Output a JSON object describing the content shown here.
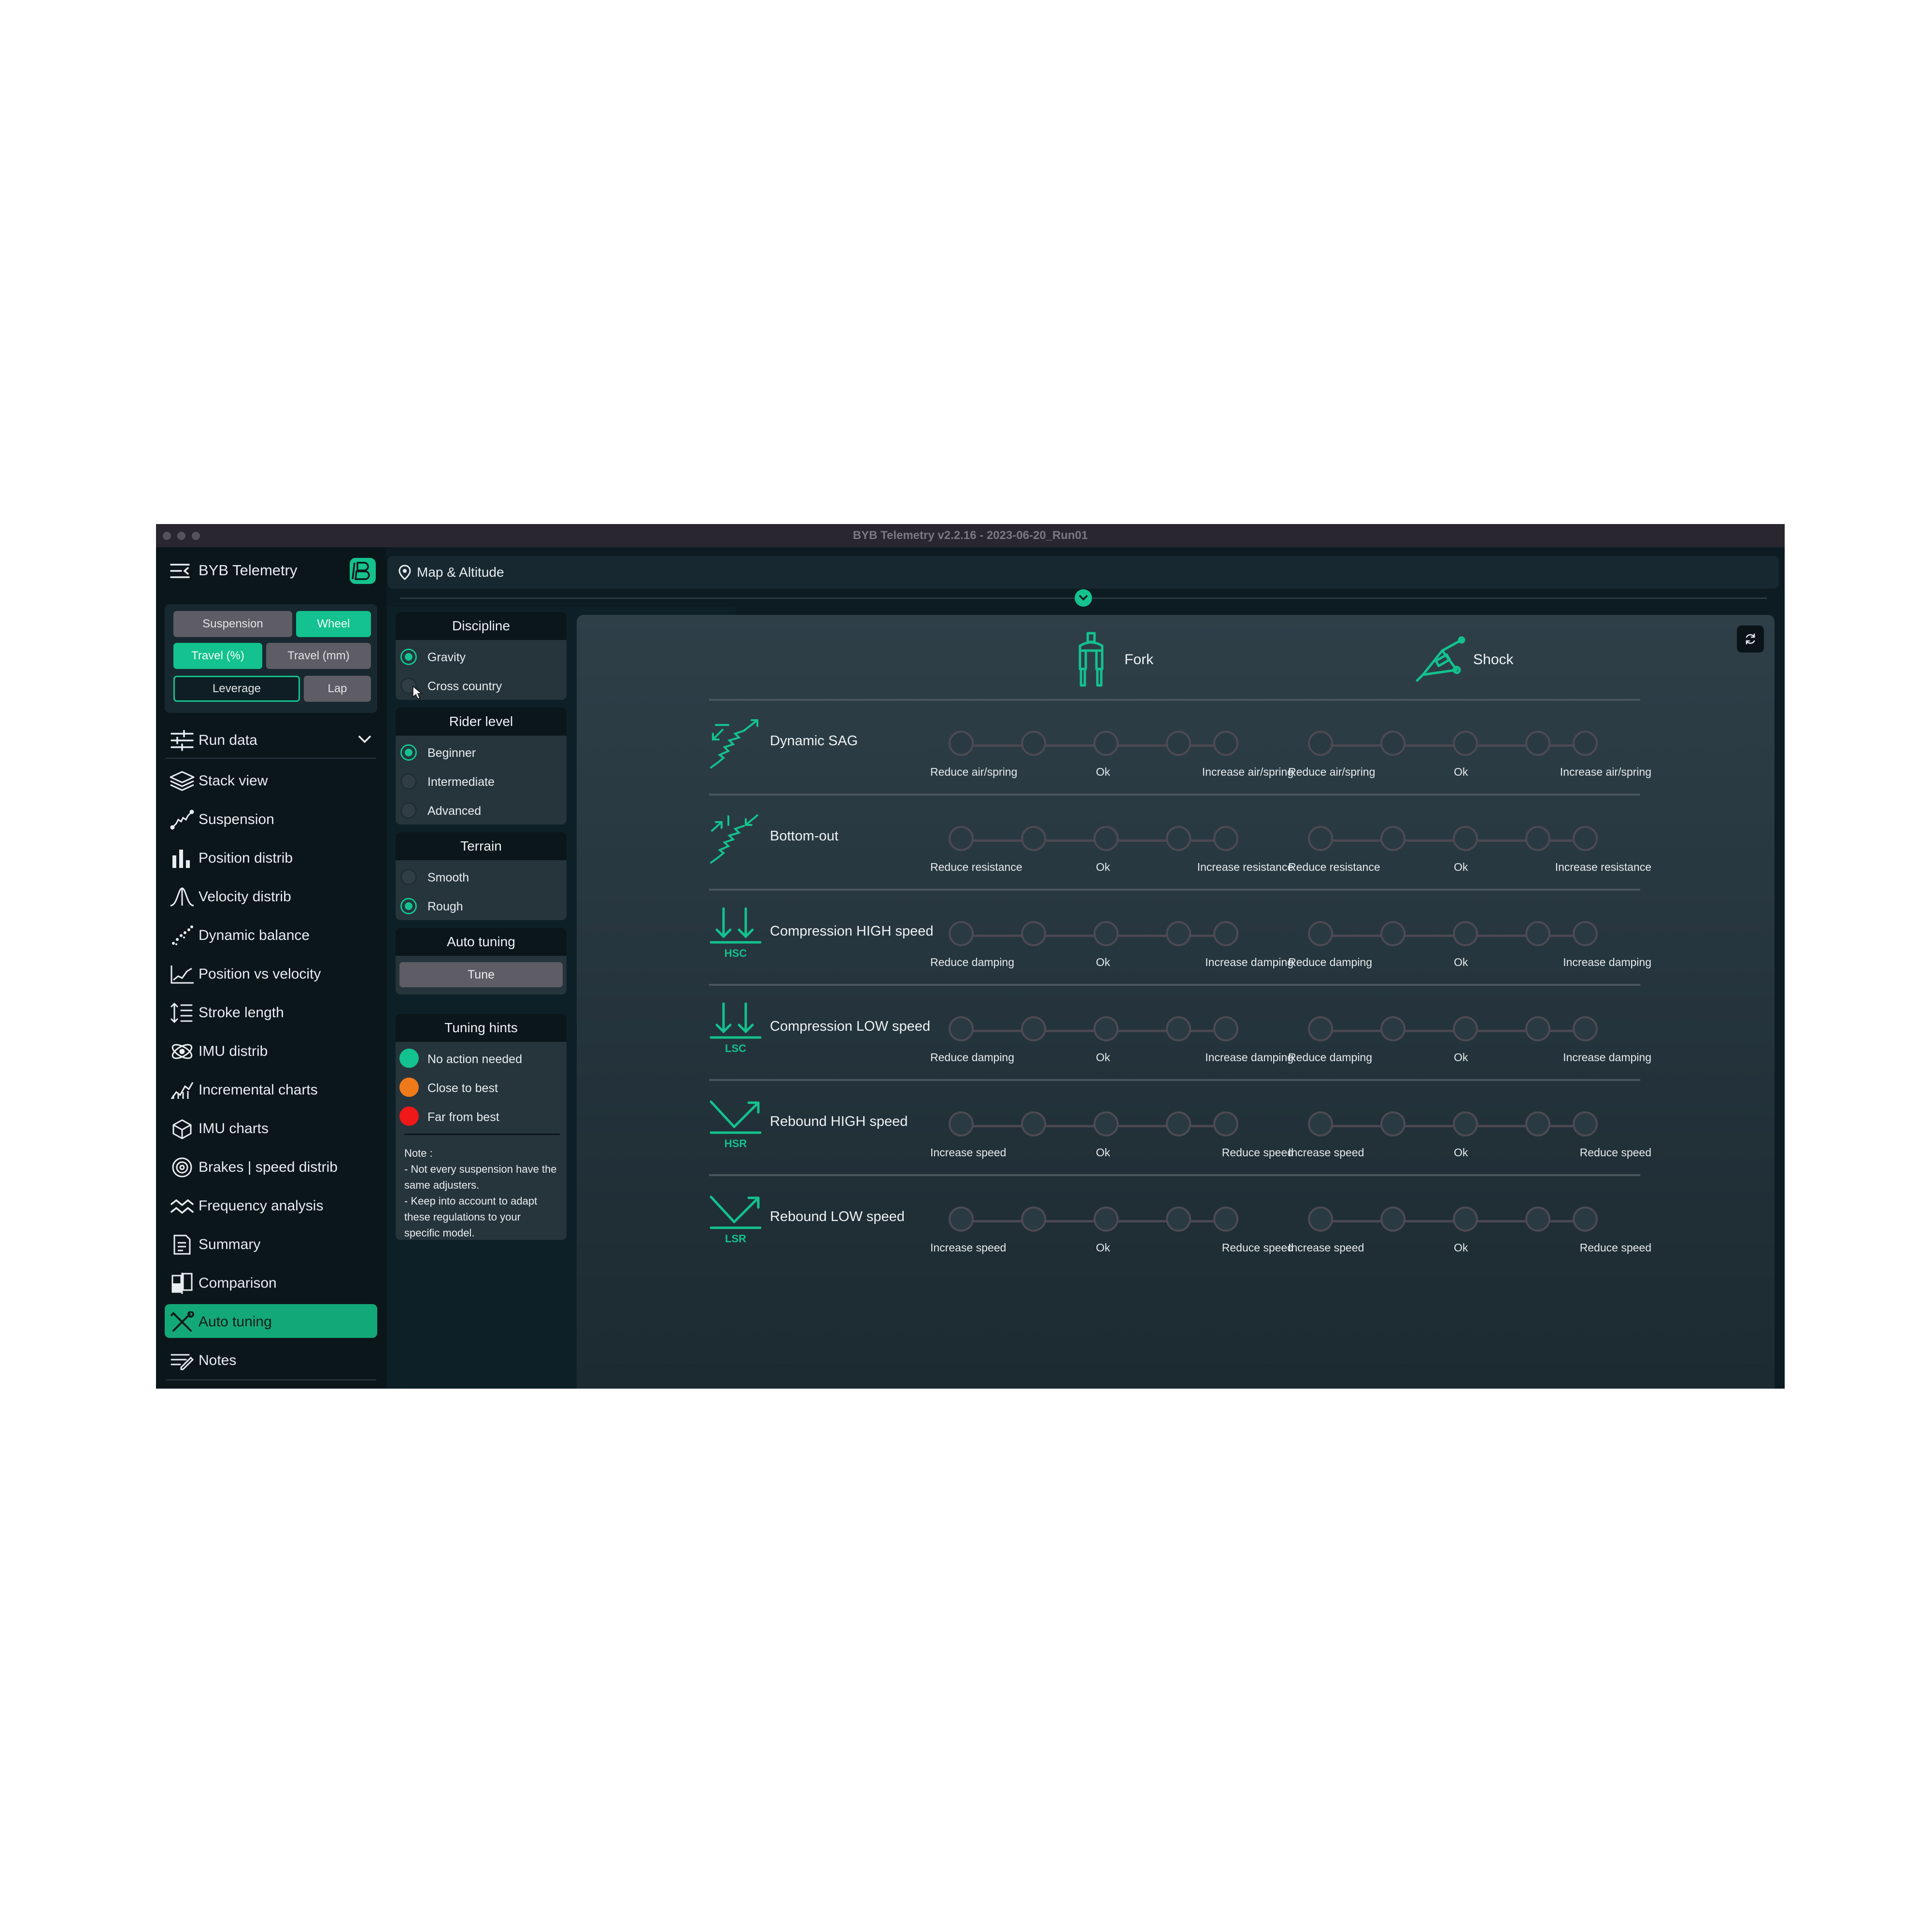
{
  "window": {
    "title": "BYB Telemetry v2.2.16 - 2023-06-20_Run01"
  },
  "app": {
    "name": "BYB Telemetry"
  },
  "topbar": {
    "label": "Map & Altitude"
  },
  "toggles": {
    "suspension": "Suspension",
    "wheel": "Wheel",
    "travel_pct": "Travel (%)",
    "travel_mm": "Travel (mm)",
    "leverage": "Leverage",
    "lap": "Lap"
  },
  "sidebar": {
    "run_data": "Run data",
    "items": [
      {
        "label": "Stack view",
        "icon": "layers-icon"
      },
      {
        "label": "Suspension",
        "icon": "shock-absorber-icon"
      },
      {
        "label": "Position distrib",
        "icon": "bar-chart-icon"
      },
      {
        "label": "Velocity distrib",
        "icon": "bell-curve-icon"
      },
      {
        "label": "Dynamic balance",
        "icon": "scatter-icon"
      },
      {
        "label": "Position vs velocity",
        "icon": "scatter-trend-icon"
      },
      {
        "label": "Stroke length",
        "icon": "stroke-length-icon"
      },
      {
        "label": "IMU distrib",
        "icon": "orbit-icon"
      },
      {
        "label": "Incremental charts",
        "icon": "line-chart-icon"
      },
      {
        "label": "IMU charts",
        "icon": "cube-axes-icon"
      },
      {
        "label": "Brakes | speed distrib",
        "icon": "brake-disc-icon"
      },
      {
        "label": "Frequency analysis",
        "icon": "wave-icon"
      },
      {
        "label": "Summary",
        "icon": "document-icon"
      },
      {
        "label": "Comparison",
        "icon": "compare-icon"
      },
      {
        "label": "Auto tuning",
        "icon": "tools-icon"
      },
      {
        "label": "Notes",
        "icon": "notes-icon"
      }
    ]
  },
  "options": {
    "discipline": {
      "title": "Discipline",
      "options": [
        "Gravity",
        "Cross country"
      ],
      "selected": "Gravity"
    },
    "rider_level": {
      "title": "Rider level",
      "options": [
        "Beginner",
        "Intermediate",
        "Advanced"
      ],
      "selected": "Beginner"
    },
    "terrain": {
      "title": "Terrain",
      "options": [
        "Smooth",
        "Rough"
      ],
      "selected": "Rough"
    },
    "auto_tuning": {
      "title": "Auto tuning",
      "button": "Tune"
    },
    "tuning_hints": {
      "title": "Tuning hints",
      "items": [
        {
          "label": "No action needed",
          "color": "#13c28e"
        },
        {
          "label": "Close to best",
          "color": "#f07a1a"
        },
        {
          "label": "Far from best",
          "color": "#f01818"
        }
      ],
      "note": [
        "Note :",
        "- Not every suspension have the same adjusters.",
        "- Keep into account to adapt these regulations to your specific model."
      ]
    }
  },
  "tuning": {
    "columns": [
      "Fork",
      "Shock"
    ],
    "rows": [
      {
        "title": "Dynamic SAG",
        "icon": "spring-expand-icon",
        "labels": [
          "Reduce air/spring",
          "Ok",
          "Increase air/spring"
        ]
      },
      {
        "title": "Bottom-out",
        "icon": "spring-compress-icon",
        "labels": [
          "Reduce resistance",
          "Ok",
          "Increase resistance"
        ]
      },
      {
        "title": "Compression HIGH speed",
        "icon": "hsc-icon",
        "abbr": "HSC",
        "labels": [
          "Reduce damping",
          "Ok",
          "Increase damping"
        ]
      },
      {
        "title": "Compression LOW speed",
        "icon": "lsc-icon",
        "abbr": "LSC",
        "labels": [
          "Reduce damping",
          "Ok",
          "Increase damping"
        ]
      },
      {
        "title": "Rebound HIGH speed",
        "icon": "hsr-icon",
        "abbr": "HSR",
        "labels": [
          "Increase speed",
          "Ok",
          "Reduce speed"
        ]
      },
      {
        "title": "Rebound LOW speed",
        "icon": "lsr-icon",
        "abbr": "LSR",
        "labels": [
          "Increase speed",
          "Ok",
          "Reduce speed"
        ]
      }
    ]
  },
  "colors": {
    "accent": "#13c28e",
    "background": "#0d1b22",
    "panel": "#26343c"
  }
}
